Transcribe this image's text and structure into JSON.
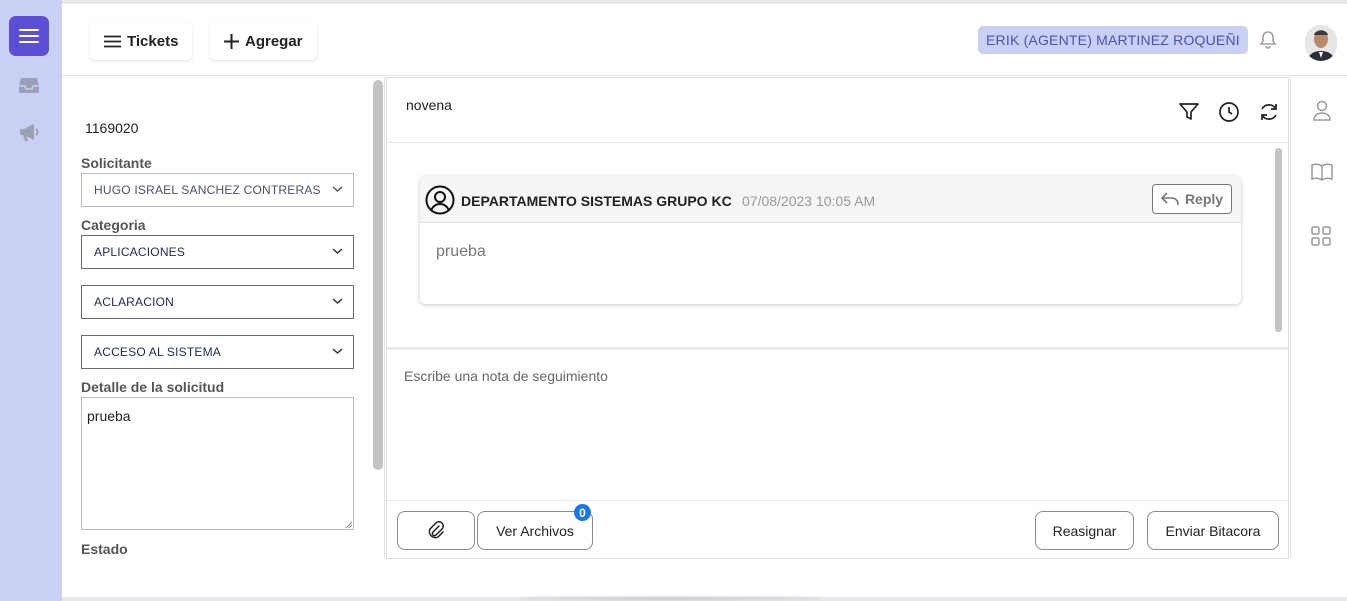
{
  "topbar": {
    "tickets_label": "Tickets",
    "add_label": "Agregar",
    "agent_name": "ERIK (AGENTE) MARTINEZ ROQUEÑI"
  },
  "ticket": {
    "id": "1169020",
    "solicitante_label": "Solicitante",
    "solicitante_value": "HUGO ISRAEL SANCHEZ CONTRERAS",
    "categoria_label": "Categoria",
    "categoria_value": "APLICACIONES",
    "subcategoria_value": "ACLARACION",
    "tipo_value": "ACCESO AL SISTEMA",
    "detalle_label": "Detalle de la solicitud",
    "detalle_value": "prueba",
    "estado_label": "Estado"
  },
  "conversation": {
    "subject": "novena",
    "messages": [
      {
        "from": "DEPARTAMENTO SISTEMAS GRUPO KC",
        "date": "07/08/2023 10:05 AM",
        "body": "prueba",
        "reply_label": "Reply"
      }
    ],
    "note_placeholder": "Escribe una nota de seguimiento",
    "ver_archivos_label": "Ver Archivos",
    "archivos_count": "0",
    "reasignar_label": "Reasignar",
    "enviar_label": "Enviar Bitacora"
  },
  "colors": {
    "rail": "#c9d0f3",
    "menu_button": "#5b4fd6",
    "agent_pill_text": "#4a52b8",
    "badge": "#1977e8"
  },
  "icons": {
    "rail": [
      "menu-icon",
      "inbox-icon",
      "megaphone-icon"
    ],
    "header": [
      "filter-icon",
      "clock-icon",
      "refresh-icon"
    ],
    "right_rail": [
      "user-icon",
      "book-icon",
      "grid-icon"
    ],
    "misc": [
      "bell-icon",
      "paperclip-icon",
      "reply-arrow-icon",
      "user-circle-icon"
    ]
  }
}
